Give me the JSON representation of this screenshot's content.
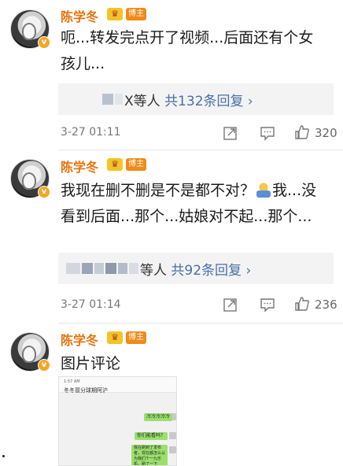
{
  "comments": [
    {
      "author": "陈学冬",
      "tag": "博主",
      "vbadge": "v",
      "crown": "♛",
      "text": "呃...转发完点开了视频...后面还有个女孩儿...",
      "reply_suffix": "X等人",
      "reply_count": "共132条回复",
      "chevron": "›",
      "time": "3-27 01:11",
      "likes": "320"
    },
    {
      "author": "陈学冬",
      "tag": "博主",
      "vbadge": "v",
      "crown": "♛",
      "text_before_emoji": "我现在删不删是不是都不对？",
      "text_after_emoji": "我...没看到后面...那个...姑娘对不起...那个...",
      "reply_suffix": "等人",
      "reply_count": "共92条回复",
      "chevron": "›",
      "time": "3-27 01:14",
      "likes": "236"
    },
    {
      "author": "陈学冬",
      "tag": "博主",
      "vbadge": "v",
      "crown": "♛",
      "text": "图片评论",
      "picture": {
        "status_bar": "1:57 AM",
        "chat_title": "冬冬冒分球期阿沪",
        "bubble_1": "冷冷冷冷冷",
        "bubble_2": "你们能看吗？",
        "bubble_3": "我在刷到了发布者，现在都怎么认为我们个一九乐机，刷了一下"
      }
    }
  ],
  "icons": {
    "share": "share-icon",
    "comment": "comment-icon",
    "like": "like-icon"
  },
  "colors": {
    "author": "#e8720c",
    "reply_link": "#4a6fa5",
    "tag_bg": "#f08a18",
    "vbadge": "#f5a623"
  }
}
